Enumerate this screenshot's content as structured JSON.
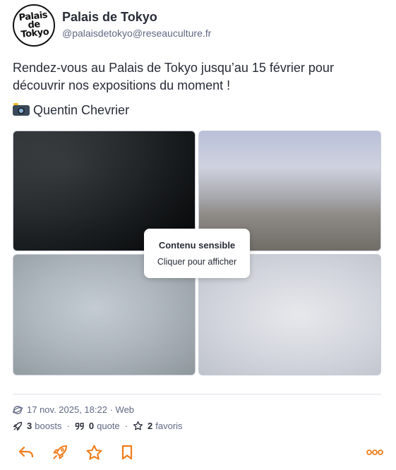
{
  "account": {
    "display_name": "Palais de Tokyo",
    "handle": "@palaisdetokyo@reseauculture.fr",
    "avatar_text": "Palais de Tokyo"
  },
  "post": {
    "text": "Rendez-vous au Palais de Tokyo jusqu’au 15 février pour découvrir nos expositions du moment !",
    "credit": "Quentin Chevrier",
    "credit_icon": "camera-flash-icon"
  },
  "media": {
    "count": 4,
    "sensitive_title": "Contenu sensible",
    "sensitive_action": "Cliquer pour afficher"
  },
  "meta": {
    "timestamp": "17 nov. 2025, 18:22",
    "visibility_icon": "globe-icon",
    "client": "Web"
  },
  "stats": {
    "boosts_count": "3",
    "boosts_label": "boosts",
    "quotes_count": "0",
    "quotes_label": "quote",
    "favs_count": "2",
    "favs_label": "favoris"
  },
  "actions": [
    "reply-icon",
    "boost-icon",
    "star-icon",
    "bookmark-icon",
    "more-icon"
  ],
  "colors": {
    "accent": "#f07d1a",
    "text": "#282c37",
    "muted": "#606984"
  }
}
